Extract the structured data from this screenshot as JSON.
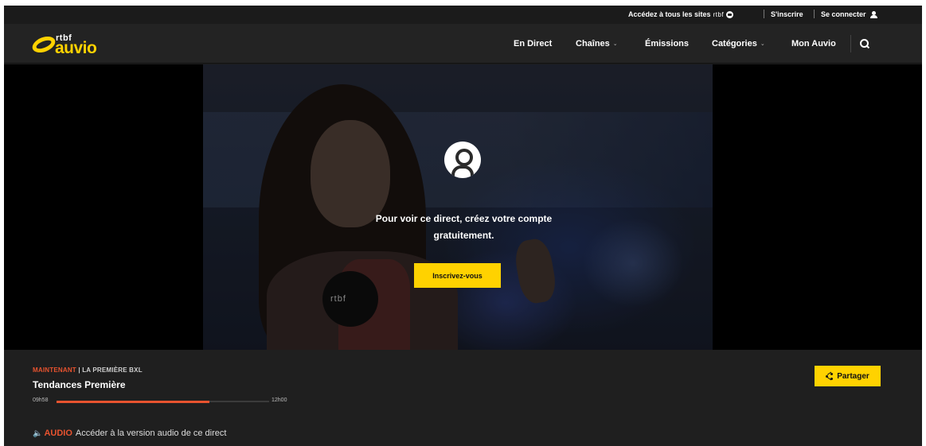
{
  "colors": {
    "accent_yellow": "#ffd200",
    "accent_orange": "#e8532f",
    "header_bg": "#232323",
    "panel_bg": "#1f1f1f"
  },
  "utility": {
    "all_sites_label": "Accédez à tous les sites",
    "rtbf_mark": "rtbf",
    "signup": "S'inscrire",
    "login": "Se connecter",
    "login_icon": "user-icon"
  },
  "header": {
    "logo": {
      "rtbf": "rtbf",
      "auvio": "auvio"
    },
    "nav": [
      {
        "label": "En Direct",
        "dropdown": false
      },
      {
        "label": "Chaînes",
        "dropdown": true
      },
      {
        "label": "Émissions",
        "dropdown": false
      },
      {
        "label": "Catégories",
        "dropdown": true
      },
      {
        "label": "Mon Auvio",
        "dropdown": false
      }
    ],
    "search_icon": "search-icon"
  },
  "player": {
    "mic_brand": "rtbf",
    "lock_icon": "user-circle-icon",
    "message": "Pour voir ce direct, créez votre compte gratuitement.",
    "cta_label": "Inscrivez-vous"
  },
  "info": {
    "now_label": "MAINTENANT",
    "channel": "| LA PREMIÈRE BXL",
    "show_title": "Tendances Première",
    "time_start": "09h58",
    "time_end": "12h00",
    "progress": 0.72,
    "share_label": "Partager",
    "share_icon": "share-icon",
    "audio_icon": "speaker-icon",
    "audio_label": "AUDIO",
    "audio_text": "Accéder à la version audio de ce direct"
  }
}
